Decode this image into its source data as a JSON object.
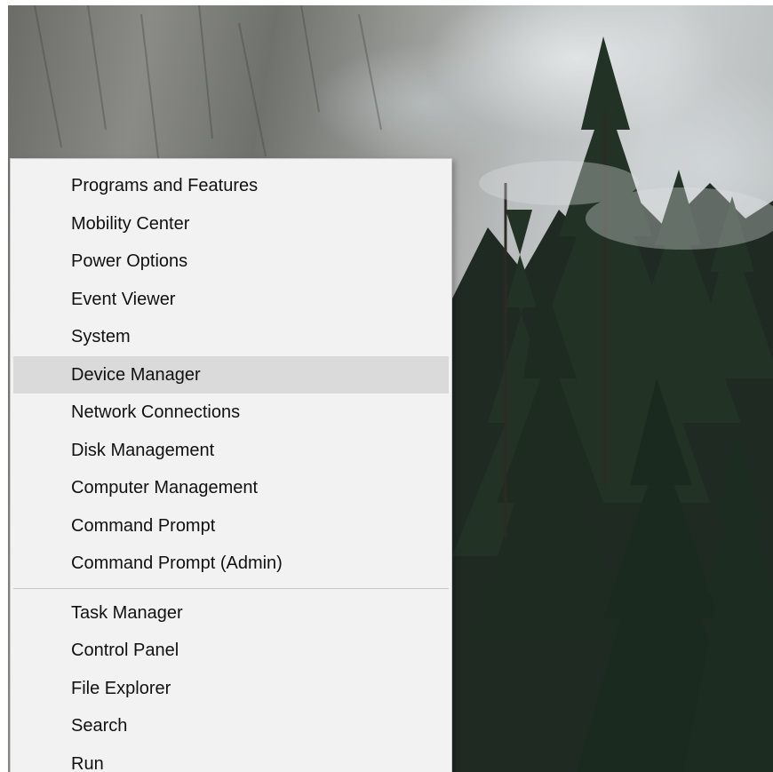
{
  "desktop": {
    "wallpaper": "misty cliff with evergreen trees"
  },
  "context_menu": {
    "highlighted_item": "Device Manager",
    "groups": [
      {
        "items": [
          {
            "label": "Programs and Features"
          },
          {
            "label": "Mobility Center"
          },
          {
            "label": "Power Options"
          },
          {
            "label": "Event Viewer"
          },
          {
            "label": "System"
          },
          {
            "label": "Device Manager"
          },
          {
            "label": "Network Connections"
          },
          {
            "label": "Disk Management"
          },
          {
            "label": "Computer Management"
          },
          {
            "label": "Command Prompt"
          },
          {
            "label": "Command Prompt (Admin)"
          }
        ]
      },
      {
        "items": [
          {
            "label": "Task Manager"
          },
          {
            "label": "Control Panel"
          },
          {
            "label": "File Explorer"
          },
          {
            "label": "Search"
          },
          {
            "label": "Run"
          }
        ]
      }
    ],
    "colors": {
      "background": "#f2f2f2",
      "highlight": "#dadada",
      "text": "#111111",
      "separator": "#c6c6c6"
    }
  }
}
